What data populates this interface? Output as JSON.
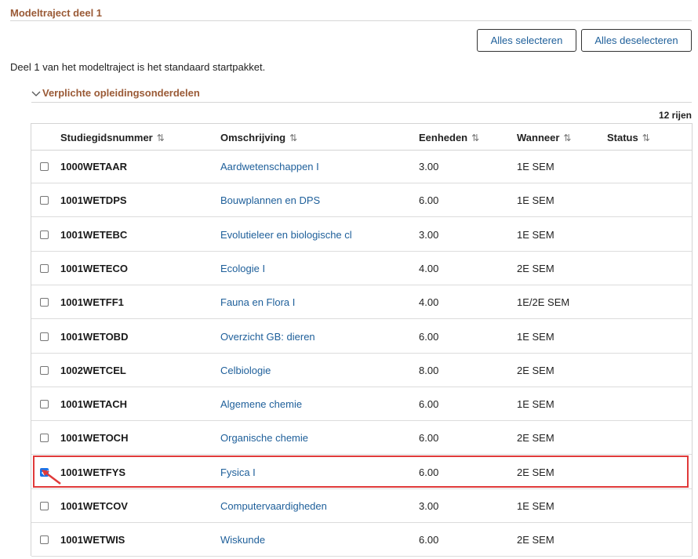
{
  "section": {
    "title": "Modeltraject deel 1"
  },
  "buttons": {
    "select_all": "Alles selecteren",
    "deselect_all": "Alles deselecteren"
  },
  "intro": "Deel 1 van het modeltraject is het standaard startpakket.",
  "subsection": {
    "title": "Verplichte opleidingsonderdelen",
    "expanded": true
  },
  "table": {
    "row_count": "12 rijen",
    "columns": [
      "Studiegidsnummer",
      "Omschrijving",
      "Eenheden",
      "Wanneer",
      "Status"
    ],
    "sort_icon": "⇅",
    "rows": [
      {
        "code": "1000WETAAR",
        "description": "Aardwetenschappen I",
        "units": "3.00",
        "when": "1E SEM",
        "status": "",
        "checked": false
      },
      {
        "code": "1001WETDPS",
        "description": "Bouwplannen en DPS",
        "units": "6.00",
        "when": "1E SEM",
        "status": "",
        "checked": false
      },
      {
        "code": "1001WETEBC",
        "description": "Evolutieleer en biologische cl",
        "units": "3.00",
        "when": "1E SEM",
        "status": "",
        "checked": false
      },
      {
        "code": "1001WETECO",
        "description": "Ecologie I",
        "units": "4.00",
        "when": "2E SEM",
        "status": "",
        "checked": false
      },
      {
        "code": "1001WETFF1",
        "description": "Fauna en Flora I",
        "units": "4.00",
        "when": "1E/2E SEM",
        "status": "",
        "checked": false
      },
      {
        "code": "1001WETOBD",
        "description": "Overzicht GB: dieren",
        "units": "6.00",
        "when": "1E SEM",
        "status": "",
        "checked": false
      },
      {
        "code": "1002WETCEL",
        "description": "Celbiologie",
        "units": "8.00",
        "when": "2E SEM",
        "status": "",
        "checked": false
      },
      {
        "code": "1001WETACH",
        "description": "Algemene chemie",
        "units": "6.00",
        "when": "1E SEM",
        "status": "",
        "checked": false
      },
      {
        "code": "1001WETOCH",
        "description": "Organische chemie",
        "units": "6.00",
        "when": "2E SEM",
        "status": "",
        "checked": false
      },
      {
        "code": "1001WETFYS",
        "description": "Fysica I",
        "units": "6.00",
        "when": "2E SEM",
        "status": "",
        "checked": true
      },
      {
        "code": "1001WETCOV",
        "description": "Computervaardigheden",
        "units": "3.00",
        "when": "1E SEM",
        "status": "",
        "checked": false
      },
      {
        "code": "1001WETWIS",
        "description": "Wiskunde",
        "units": "6.00",
        "when": "2E SEM",
        "status": "",
        "checked": false
      }
    ]
  },
  "colors": {
    "accent_brown": "#9a5a36",
    "link_blue": "#1e5f9a",
    "highlight_red": "#e03a3a",
    "checkbox_blue": "#1a73e8"
  }
}
